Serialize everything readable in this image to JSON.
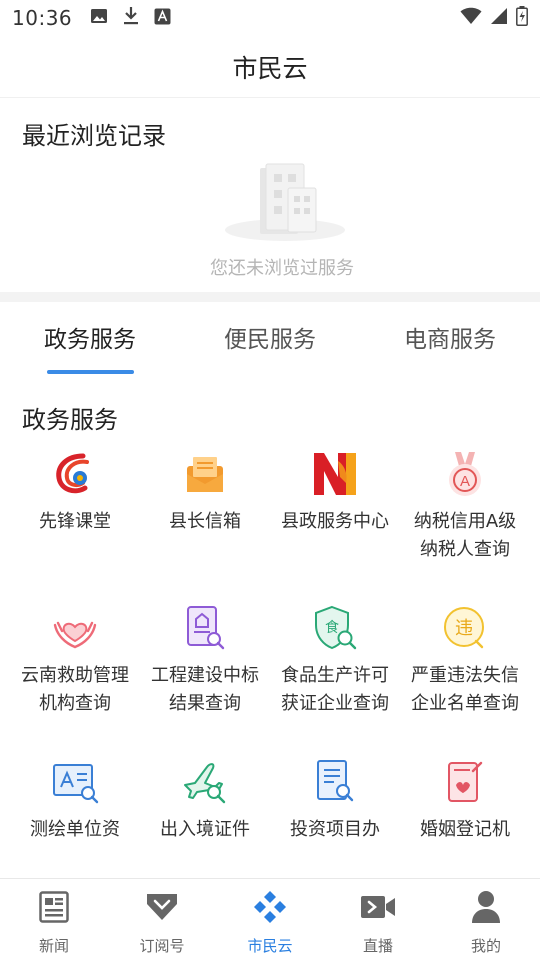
{
  "status_bar": {
    "time": "10:36"
  },
  "header": {
    "title": "市民云"
  },
  "recent": {
    "title": "最近浏览记录",
    "empty_text": "您还未浏览过服务"
  },
  "tabs": [
    {
      "label": "政务服务",
      "active": true
    },
    {
      "label": "便民服务",
      "active": false
    },
    {
      "label": "电商服务",
      "active": false
    }
  ],
  "section": {
    "title": "政务服务"
  },
  "services": [
    {
      "label": "先锋课堂",
      "icon": "pioneer-swirl-icon"
    },
    {
      "label": "县长信箱",
      "icon": "mailbox-icon"
    },
    {
      "label": "县政服务中心",
      "icon": "n-logo-icon"
    },
    {
      "label": "纳税信用A级纳税人查询",
      "icon": "medal-a-icon"
    },
    {
      "label": "云南救助管理机构查询",
      "icon": "heart-hands-icon"
    },
    {
      "label": "工程建设中标结果查询",
      "icon": "document-search-icon"
    },
    {
      "label": "食品生产许可获证企业查询",
      "icon": "food-shield-icon"
    },
    {
      "label": "严重违法失信企业名单查询",
      "icon": "violation-badge-icon"
    },
    {
      "label": "测绘单位资",
      "icon": "survey-board-icon"
    },
    {
      "label": "出入境证件",
      "icon": "airplane-search-icon"
    },
    {
      "label": "投资项目办",
      "icon": "invest-document-icon"
    },
    {
      "label": "婚姻登记机",
      "icon": "marriage-register-icon"
    }
  ],
  "bottom_nav": [
    {
      "label": "新闻",
      "icon": "news-icon",
      "active": false
    },
    {
      "label": "订阅号",
      "icon": "subscribe-icon",
      "active": false
    },
    {
      "label": "市民云",
      "icon": "citizen-cloud-icon",
      "active": true
    },
    {
      "label": "直播",
      "icon": "live-video-icon",
      "active": false
    },
    {
      "label": "我的",
      "icon": "profile-icon",
      "active": false
    }
  ],
  "colors": {
    "accent": "#2a7fe0",
    "tab_indicator": "#3a8be6",
    "muted_text": "#b5b5b5"
  }
}
